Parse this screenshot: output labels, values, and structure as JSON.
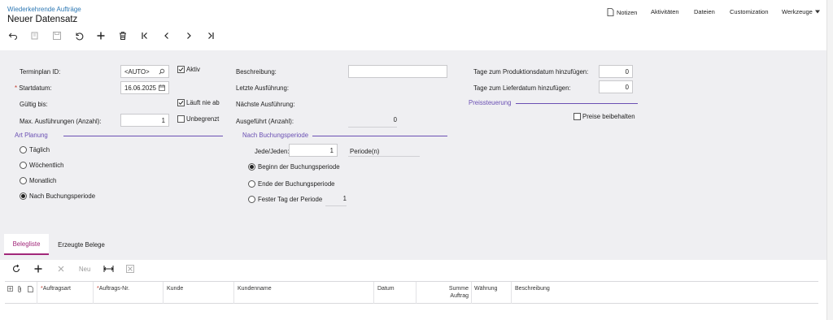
{
  "header": {
    "breadcrumb": "Wiederkehrende Aufträge",
    "title": "Neuer Datensatz",
    "links": {
      "notes": "Notizen",
      "activities": "Aktivitäten",
      "files": "Dateien",
      "customization": "Customization",
      "tools": "Werkzeuge"
    }
  },
  "toolbar": {
    "icons": [
      "undo-back-icon",
      "copy-icon",
      "save-icon",
      "undo-icon",
      "add-icon",
      "delete-icon",
      "first-icon",
      "previous-icon",
      "next-icon",
      "last-icon"
    ]
  },
  "form": {
    "schedule_id_label": "Terminplan ID:",
    "schedule_id_value": "<AUTO>",
    "active_label": "Aktiv",
    "start_date_label": "Startdatum:",
    "start_date_value": "16.06.2025",
    "valid_until_label": "Gültig bis:",
    "never_expires_label": "Läuft nie ab",
    "max_runs_label": "Max. Ausführungen (Anzahl):",
    "max_runs_value": "1",
    "unlimited_label": "Unbegrenzt",
    "description_label": "Beschreibung:",
    "description_value": "",
    "last_run_label": "Letzte Ausführung:",
    "next_run_label": "Nächste Ausführung:",
    "executed_label": "Ausgeführt (Anzahl):",
    "executed_value": "0",
    "prod_days_label": "Tage zum Produktionsdatum hinzufügen:",
    "prod_days_value": "0",
    "delivery_days_label": "Tage zum Lieferdatum hinzufügen:",
    "delivery_days_value": "0",
    "price_control_heading": "Preissteuerung",
    "keep_prices_label": "Preise beibehalten",
    "schedule_type_heading": "Art Planung",
    "schedule_options": [
      "Täglich",
      "Wöchentlich",
      "Monatlich",
      "Nach Buchungsperiode"
    ],
    "schedule_selected": "Nach Buchungsperiode",
    "by_period_heading": "Nach Buchungsperiode",
    "every_label": "Jede/Jeden:",
    "every_value": "1",
    "period_unit": "Periode(n)",
    "period_options": [
      "Beginn der Buchungsperiode",
      "Ende der Buchungsperiode",
      "Fester Tag der Periode"
    ],
    "period_selected": "Beginn der Buchungsperiode",
    "fixed_day_value": "1",
    "checkbox_states": {
      "active": true,
      "never_expires": true,
      "unlimited": false,
      "keep_prices": false
    }
  },
  "tabs": [
    "Belegliste",
    "Erzeugte Belege"
  ],
  "grid_toolbar": {
    "new_label": "Neu",
    "icons": [
      "refresh-icon",
      "add-icon",
      "delete-icon",
      "fit-columns-icon",
      "export-excel-icon"
    ]
  },
  "grid": {
    "columns": {
      "order_type": "Auftragsart",
      "order_nr": "Auftrags-Nr.",
      "customer": "Kunde",
      "customer_name": "Kundenname",
      "date": "Datum",
      "sum_line1": "Summe",
      "sum_line2": "Auftrag",
      "currency": "Währung",
      "description": "Beschreibung"
    }
  },
  "colors": {
    "accent": "#6a4fb3",
    "tab_active": "#a2287a",
    "link": "#2f79b4",
    "form_bg": "#efeff2"
  }
}
